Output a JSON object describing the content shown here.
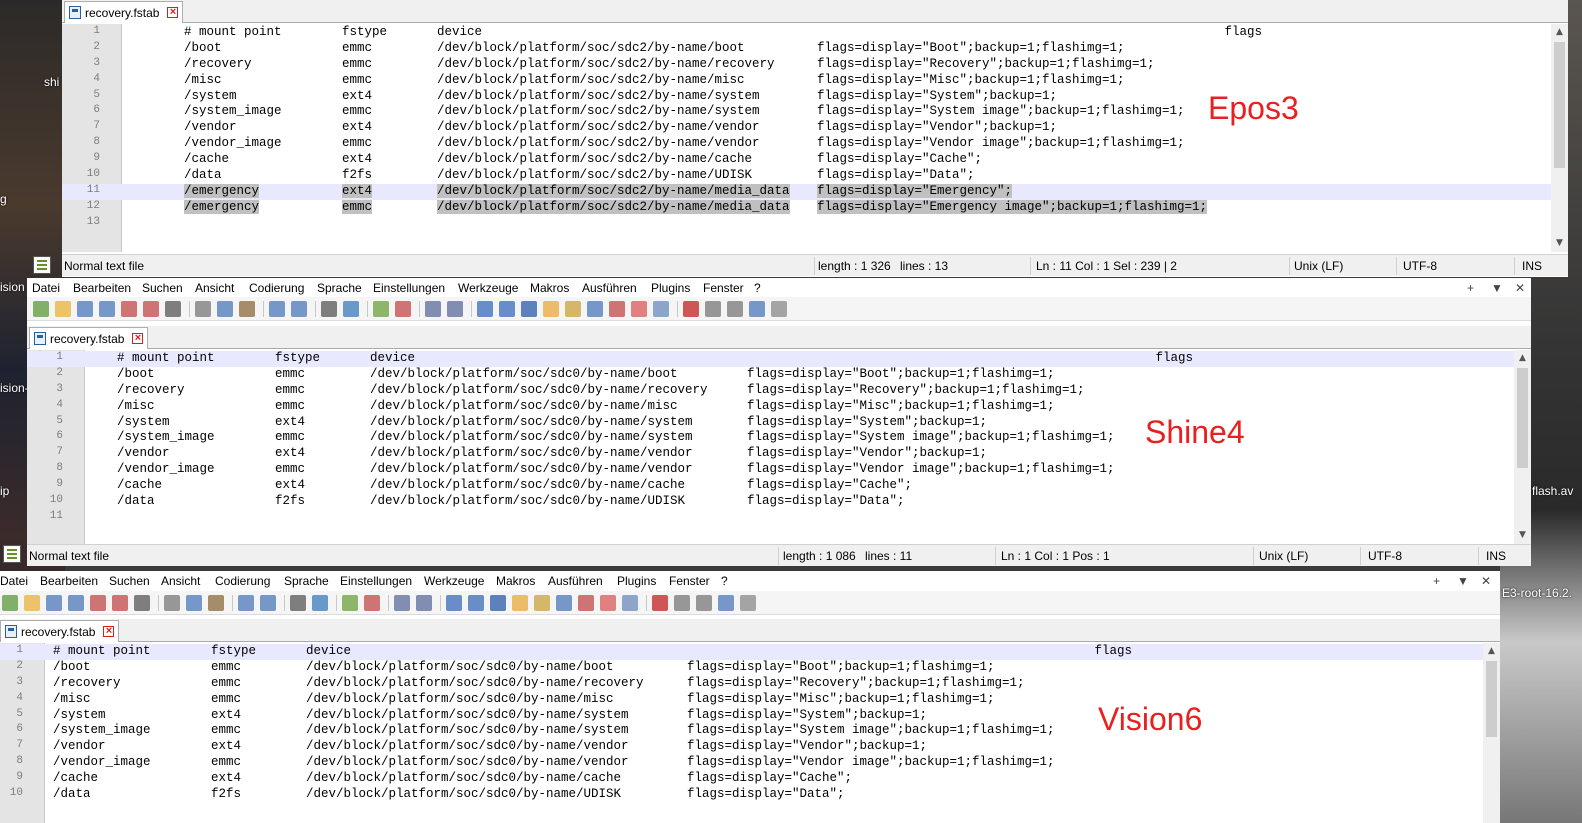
{
  "desktop": {
    "left_labels": [
      "shi",
      "g",
      "ision",
      "ision-",
      "ip"
    ],
    "right_labels": [
      "flash.av",
      "E3-root-16.2."
    ]
  },
  "menu_labels": [
    "Datei",
    "Bearbeiten",
    "Suchen",
    "Ansicht",
    "Codierung",
    "Sprache",
    "Einstellungen",
    "Werkzeuge",
    "Makros",
    "Ausführen",
    "Plugins",
    "Fenster",
    "?"
  ],
  "window_controls": {
    "add": "+",
    "menu": "▼",
    "close": "✕"
  },
  "windows": [
    {
      "tab_label": "recovery.fstab",
      "annotation": "Epos3",
      "lines": [
        [
          "# mount point",
          "fstype",
          "device",
          "                               flags"
        ],
        [
          "/boot",
          "emmc",
          "/dev/block/platform/soc/sdc2/by-name/boot",
          "flags=display=\"Boot\";backup=1;flashimg=1;"
        ],
        [
          "/recovery",
          "emmc",
          "/dev/block/platform/soc/sdc2/by-name/recovery",
          "flags=display=\"Recovery\";backup=1;flashimg=1;"
        ],
        [
          "/misc",
          "emmc",
          "/dev/block/platform/soc/sdc2/by-name/misc",
          "flags=display=\"Misc\";backup=1;flashimg=1;"
        ],
        [
          "/system",
          "ext4",
          "/dev/block/platform/soc/sdc2/by-name/system",
          "flags=display=\"System\";backup=1;"
        ],
        [
          "/system_image",
          "emmc",
          "/dev/block/platform/soc/sdc2/by-name/system",
          "flags=display=\"System image\";backup=1;flashimg=1;"
        ],
        [
          "/vendor",
          "ext4",
          "/dev/block/platform/soc/sdc2/by-name/vendor",
          "flags=display=\"Vendor\";backup=1;"
        ],
        [
          "/vendor_image",
          "emmc",
          "/dev/block/platform/soc/sdc2/by-name/vendor",
          "flags=display=\"Vendor image\";backup=1;flashimg=1;"
        ],
        [
          "/cache",
          "ext4",
          "/dev/block/platform/soc/sdc2/by-name/cache",
          "flags=display=\"Cache\";"
        ],
        [
          "/data",
          "f2fs",
          "/dev/block/platform/soc/sdc2/by-name/UDISK",
          "flags=display=\"Data\";"
        ],
        [
          "/emergency",
          "ext4",
          "/dev/block/platform/soc/sdc2/by-name/media_data",
          "flags=display=\"Emergency\";"
        ],
        [
          "/emergency",
          "emmc",
          "/dev/block/platform/soc/sdc2/by-name/media_data",
          "flags=display=\"Emergency image\";backup=1;flashimg=1;"
        ],
        [
          "",
          "",
          "",
          ""
        ]
      ],
      "status": {
        "type": "Normal text file",
        "length": "length : 1 326",
        "lines": "lines : 13",
        "pos": "Ln : 11    Col : 1    Sel : 239 | 2",
        "eol": "Unix (LF)",
        "enc": "UTF-8",
        "mode": "INS"
      }
    },
    {
      "tab_label": "recovery.fstab",
      "annotation": "Shine4",
      "lines": [
        [
          "# mount point",
          "fstype",
          "device",
          "                               flags"
        ],
        [
          "/boot",
          "emmc",
          "/dev/block/platform/soc/sdc0/by-name/boot",
          "flags=display=\"Boot\";backup=1;flashimg=1;"
        ],
        [
          "/recovery",
          "emmc",
          "/dev/block/platform/soc/sdc0/by-name/recovery",
          "flags=display=\"Recovery\";backup=1;flashimg=1;"
        ],
        [
          "/misc",
          "emmc",
          "/dev/block/platform/soc/sdc0/by-name/misc",
          "flags=display=\"Misc\";backup=1;flashimg=1;"
        ],
        [
          "/system",
          "ext4",
          "/dev/block/platform/soc/sdc0/by-name/system",
          "flags=display=\"System\";backup=1;"
        ],
        [
          "/system_image",
          "emmc",
          "/dev/block/platform/soc/sdc0/by-name/system",
          "flags=display=\"System image\";backup=1;flashimg=1;"
        ],
        [
          "/vendor",
          "ext4",
          "/dev/block/platform/soc/sdc0/by-name/vendor",
          "flags=display=\"Vendor\";backup=1;"
        ],
        [
          "/vendor_image",
          "emmc",
          "/dev/block/platform/soc/sdc0/by-name/vendor",
          "flags=display=\"Vendor image\";backup=1;flashimg=1;"
        ],
        [
          "/cache",
          "ext4",
          "/dev/block/platform/soc/sdc0/by-name/cache",
          "flags=display=\"Cache\";"
        ],
        [
          "/data",
          "f2fs",
          "/dev/block/platform/soc/sdc0/by-name/UDISK",
          "flags=display=\"Data\";"
        ],
        [
          "",
          "",
          "",
          ""
        ]
      ],
      "status": {
        "type": "Normal text file",
        "length": "length : 1 086",
        "lines": "lines : 11",
        "pos": "Ln : 1    Col : 1    Pos : 1",
        "eol": "Unix (LF)",
        "enc": "UTF-8",
        "mode": "INS"
      }
    },
    {
      "tab_label": "recovery.fstab",
      "annotation": "Vision6",
      "lines": [
        [
          "# mount point",
          "fstype",
          "device",
          "                               flags"
        ],
        [
          "/boot",
          "emmc",
          "/dev/block/platform/soc/sdc0/by-name/boot",
          "flags=display=\"Boot\";backup=1;flashimg=1;"
        ],
        [
          "/recovery",
          "emmc",
          "/dev/block/platform/soc/sdc0/by-name/recovery",
          "flags=display=\"Recovery\";backup=1;flashimg=1;"
        ],
        [
          "/misc",
          "emmc",
          "/dev/block/platform/soc/sdc0/by-name/misc",
          "flags=display=\"Misc\";backup=1;flashimg=1;"
        ],
        [
          "/system",
          "ext4",
          "/dev/block/platform/soc/sdc0/by-name/system",
          "flags=display=\"System\";backup=1;"
        ],
        [
          "/system_image",
          "emmc",
          "/dev/block/platform/soc/sdc0/by-name/system",
          "flags=display=\"System image\";backup=1;flashimg=1;"
        ],
        [
          "/vendor",
          "ext4",
          "/dev/block/platform/soc/sdc0/by-name/vendor",
          "flags=display=\"Vendor\";backup=1;"
        ],
        [
          "/vendor_image",
          "emmc",
          "/dev/block/platform/soc/sdc0/by-name/vendor",
          "flags=display=\"Vendor image\";backup=1;flashimg=1;"
        ],
        [
          "/cache",
          "ext4",
          "/dev/block/platform/soc/sdc0/by-name/cache",
          "flags=display=\"Cache\";"
        ],
        [
          "/data",
          "f2fs",
          "/dev/block/platform/soc/sdc0/by-name/UDISK",
          "flags=display=\"Data\";"
        ]
      ]
    }
  ]
}
